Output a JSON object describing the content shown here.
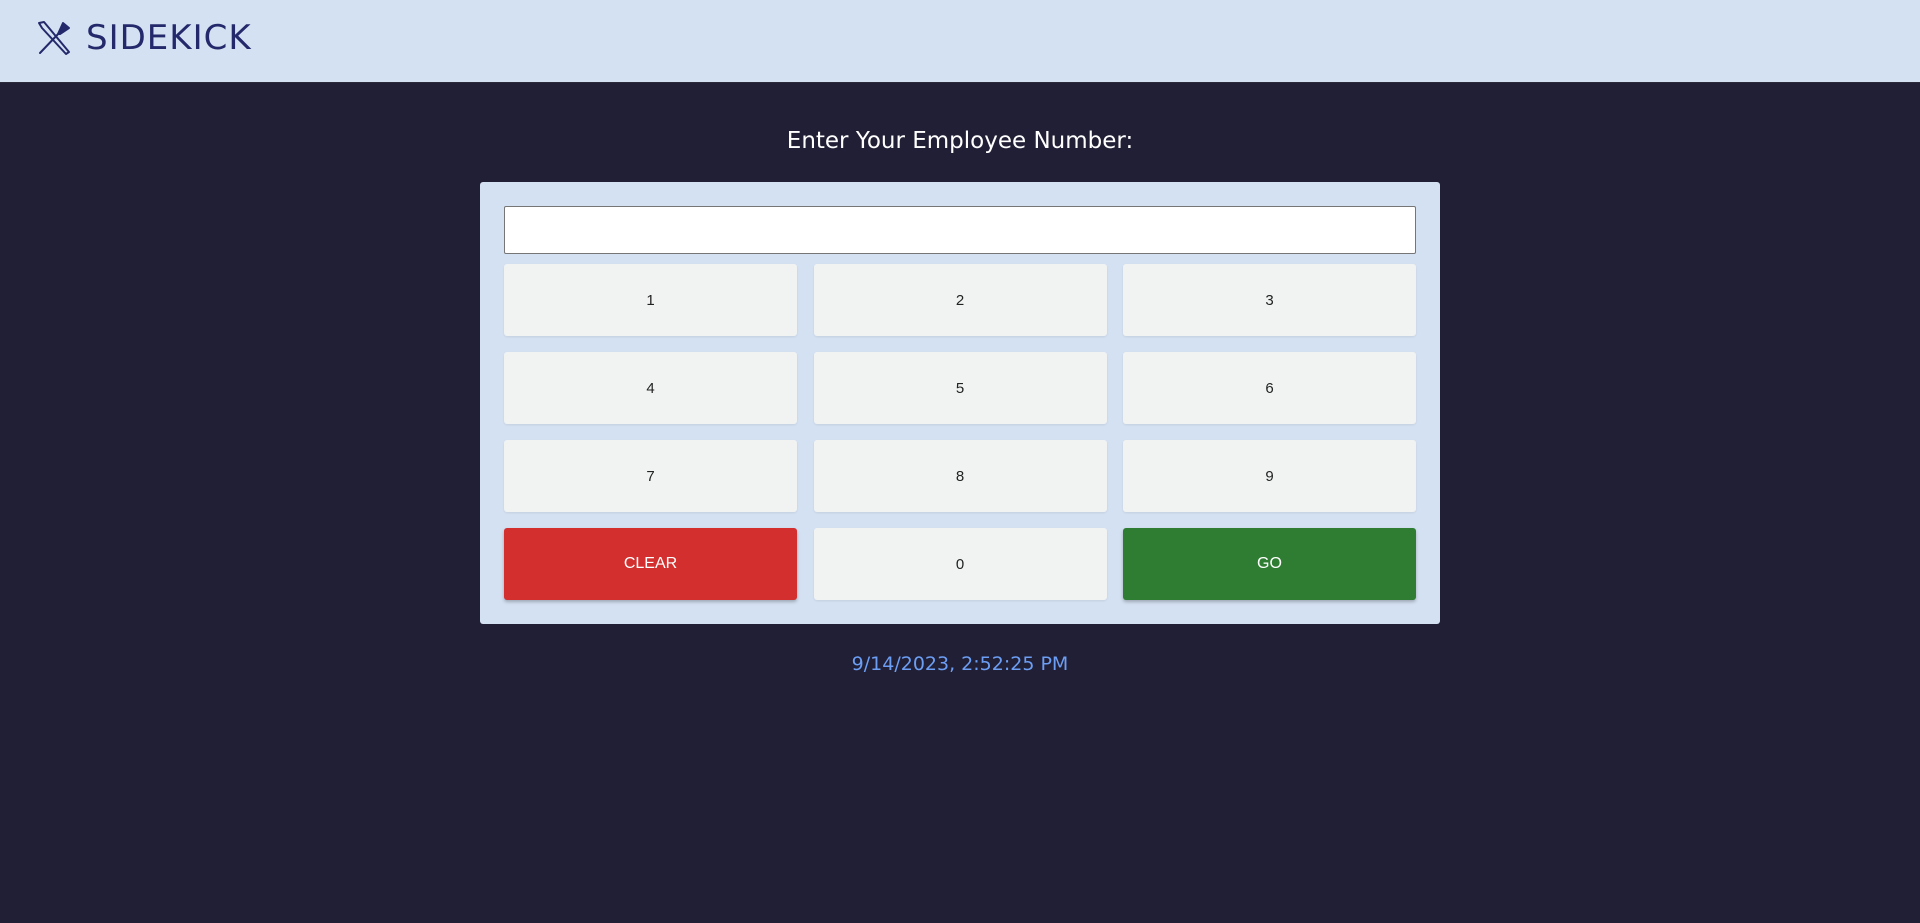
{
  "header": {
    "brand": "SIDEKICK",
    "logo_icon": "utensils-crossed-icon",
    "background": "#d4e1f2",
    "brand_color": "#23296b"
  },
  "prompt": "Enter Your Employee Number:",
  "pin_input": {
    "value": "",
    "placeholder": ""
  },
  "keypad": {
    "keys": [
      "1",
      "2",
      "3",
      "4",
      "5",
      "6",
      "7",
      "8",
      "9"
    ],
    "clear_label": "CLEAR",
    "zero_label": "0",
    "go_label": "GO",
    "clear_color": "#d32f2f",
    "go_color": "#2e7d32"
  },
  "datetime": "9/14/2023, 2:52:25 PM",
  "colors": {
    "page_background": "#211f35",
    "panel_background": "#d4e1f2",
    "key_background": "#f1f3f2",
    "datetime_color": "#6c9ef4"
  }
}
